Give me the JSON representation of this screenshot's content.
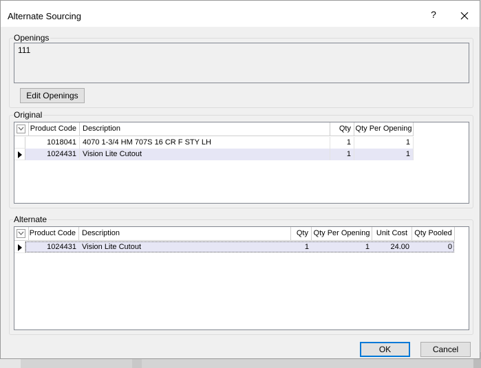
{
  "window": {
    "title": "Alternate Sourcing",
    "help_label": "?"
  },
  "openings": {
    "legend": "Openings",
    "value": "111",
    "edit_button": "Edit Openings"
  },
  "original": {
    "legend": "Original",
    "columns": [
      "Product Code",
      "Description",
      "Qty",
      "Qty Per Opening"
    ],
    "rows": [
      {
        "product_code": "1018041",
        "description": "4070 1-3/4 HM 707S 16 CR F STY LH",
        "qty": "1",
        "qty_per_opening": "1",
        "selected": false
      },
      {
        "product_code": "1024431",
        "description": "Vision Lite Cutout",
        "qty": "1",
        "qty_per_opening": "1",
        "selected": true
      }
    ]
  },
  "alternate": {
    "legend": "Alternate",
    "columns": [
      "Product Code",
      "Description",
      "Qty",
      "Qty Per Opening",
      "Unit Cost",
      "Qty Pooled"
    ],
    "rows": [
      {
        "product_code": "1024431",
        "description": "Vision Lite Cutout",
        "qty": "1",
        "qty_per_opening": "1",
        "unit_cost": "24.00",
        "qty_pooled": "0",
        "selected": true
      }
    ]
  },
  "footer": {
    "ok_label": "OK",
    "cancel_label": "Cancel"
  },
  "colors": {
    "selected_row": "#e6e6f5",
    "default_button_border": "#0078d7"
  }
}
